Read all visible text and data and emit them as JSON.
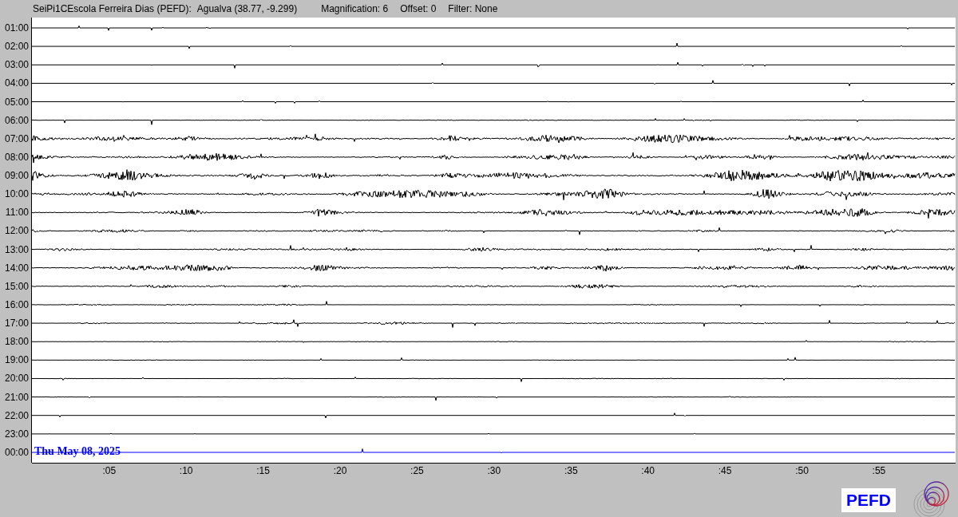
{
  "header": {
    "station": "SeiPi1CEscola Ferreira Dias (PEFD):",
    "location": "Agualva (38.77, -9.299)",
    "magnification": "Magnification: 6",
    "offset": "Offset: 0",
    "filter": "Filter: None"
  },
  "rows": [
    {
      "label": "01:00",
      "current": false
    },
    {
      "label": "02:00",
      "current": false
    },
    {
      "label": "03:00",
      "current": false
    },
    {
      "label": "04:00",
      "current": false
    },
    {
      "label": "05:00",
      "current": false
    },
    {
      "label": "06:00",
      "current": false
    },
    {
      "label": "07:00",
      "current": false
    },
    {
      "label": "08:00",
      "current": false
    },
    {
      "label": "09:00",
      "current": false
    },
    {
      "label": "10:00",
      "current": false
    },
    {
      "label": "11:00",
      "current": false
    },
    {
      "label": "12:00",
      "current": false
    },
    {
      "label": "13:00",
      "current": false
    },
    {
      "label": "14:00",
      "current": false
    },
    {
      "label": "15:00",
      "current": false
    },
    {
      "label": "16:00",
      "current": false
    },
    {
      "label": "17:00",
      "current": false
    },
    {
      "label": "18:00",
      "current": false
    },
    {
      "label": "19:00",
      "current": false
    },
    {
      "label": "20:00",
      "current": false
    },
    {
      "label": "21:00",
      "current": false
    },
    {
      "label": "22:00",
      "current": false
    },
    {
      "label": "23:00",
      "current": false
    },
    {
      "label": "00:00",
      "current": true
    }
  ],
  "date_label": "Thu May 08, 2025",
  "minute_ticks": [
    ":05",
    ":10",
    ":15",
    ":20",
    ":25",
    ":30",
    ":35",
    ":40",
    ":45",
    ":50",
    ":55"
  ],
  "logo_text": "PEFD"
}
